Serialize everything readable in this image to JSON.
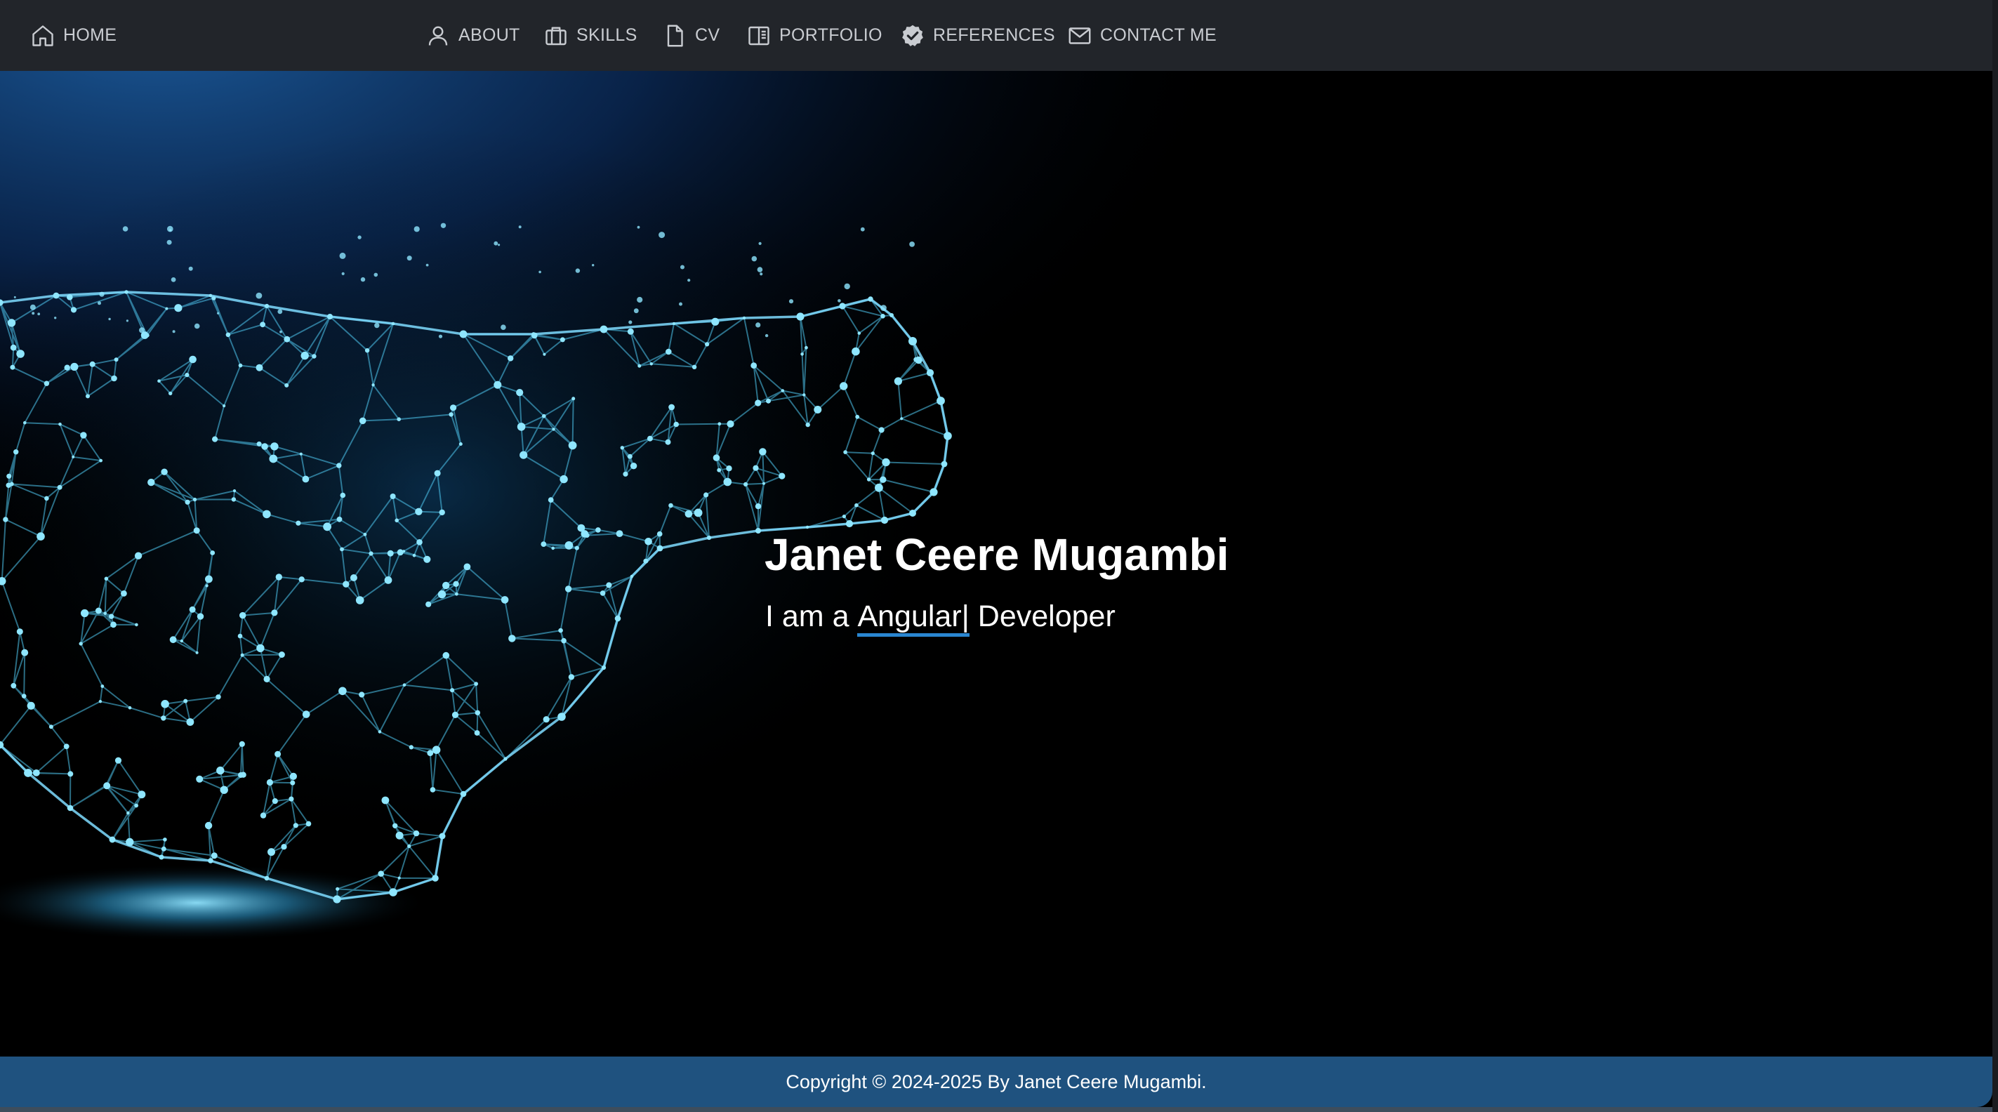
{
  "nav": {
    "home": "HOME",
    "about": "ABOUT",
    "skills": "SKILLS",
    "cv": "CV",
    "portfolio": "PORTFOLIO",
    "references": "REFERENCES",
    "contact": "CONTACT ME",
    "icons": [
      "home-icon",
      "user-icon",
      "briefcase-icon",
      "document-icon",
      "book-icon",
      "badge-check-icon",
      "envelope-icon"
    ]
  },
  "hero": {
    "name": "Janet Ceere Mugambi",
    "subtitle_prefix": "I am a ",
    "typed_word": "Angular|",
    "subtitle_suffix": " Developer",
    "illustration": "wireframe-cheetah"
  },
  "footer": {
    "copyright": "Copyright © 2024-2025 By Janet Ceere Mugambi."
  },
  "colors": {
    "navbar_bg": "#22252a",
    "nav_text": "#c9ccd1",
    "hero_bg": "#000000",
    "accent_underline": "#2a86d1",
    "footer_bg": "#1f527f",
    "wireframe_glow": "#4fc6ee"
  }
}
